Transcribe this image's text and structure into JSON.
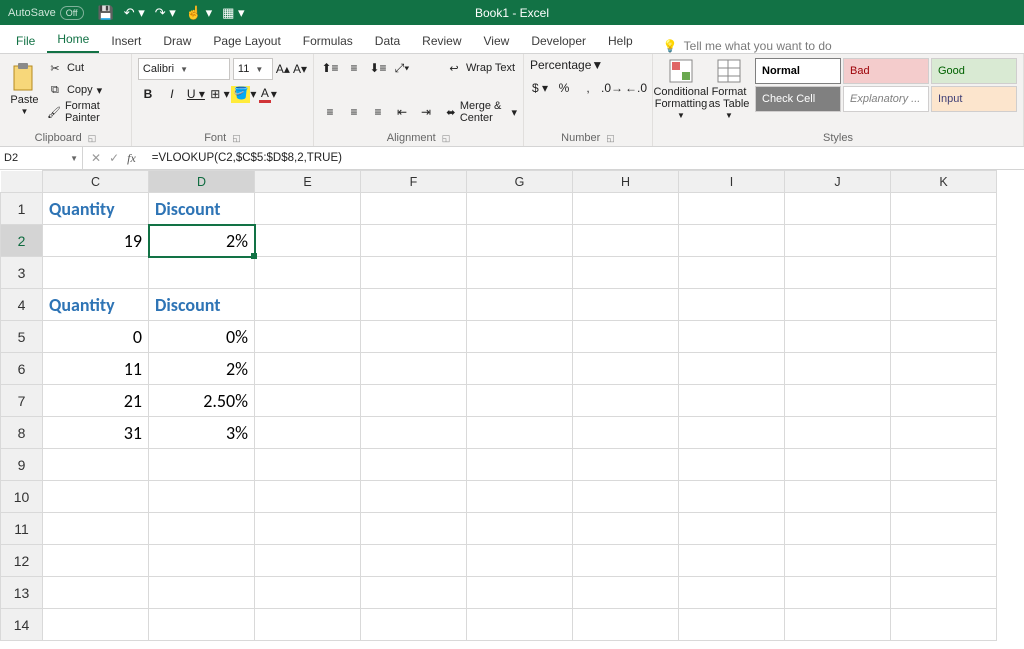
{
  "titlebar": {
    "autosave_label": "AutoSave",
    "autosave_state": "Off",
    "document_title": "Book1 - Excel"
  },
  "tabs": {
    "items": [
      "File",
      "Home",
      "Insert",
      "Draw",
      "Page Layout",
      "Formulas",
      "Data",
      "Review",
      "View",
      "Developer",
      "Help"
    ],
    "active_index": 1,
    "tell_me": "Tell me what you want to do"
  },
  "ribbon": {
    "clipboard": {
      "paste": "Paste",
      "cut": "Cut",
      "copy": "Copy",
      "format_painter": "Format Painter",
      "group_label": "Clipboard"
    },
    "font": {
      "name": "Calibri",
      "size": "11",
      "group_label": "Font"
    },
    "alignment": {
      "wrap": "Wrap Text",
      "merge": "Merge & Center",
      "group_label": "Alignment"
    },
    "number": {
      "format": "Percentage",
      "group_label": "Number"
    },
    "styles": {
      "cond_fmt": "Conditional Formatting",
      "table": "Format as Table",
      "cells": [
        "Normal",
        "Bad",
        "Good",
        "Check Cell",
        "Explanatory ...",
        "Input"
      ],
      "group_label": "Styles"
    }
  },
  "formula_bar": {
    "name_box": "D2",
    "formula": "=VLOOKUP(C2,$C$5:$D$8,2,TRUE)"
  },
  "sheet": {
    "columns": [
      "C",
      "D",
      "E",
      "F",
      "G",
      "H",
      "I",
      "J",
      "K"
    ],
    "rows": [
      1,
      2,
      3,
      4,
      5,
      6,
      7,
      8,
      9,
      10,
      11,
      12,
      13,
      14
    ],
    "selected": {
      "row": 2,
      "col": "D"
    },
    "data": {
      "C1": "Quantity",
      "D1": "Discount",
      "C2": "19",
      "D2": "2%",
      "C4": "Quantity",
      "D4": "Discount",
      "C5": "0",
      "D5": "0%",
      "C6": "11",
      "D6": "2%",
      "C7": "21",
      "D7": "2.50%",
      "C8": "31",
      "D8": "3%"
    },
    "header_cells": [
      "C1",
      "D1",
      "C4",
      "D4"
    ]
  }
}
